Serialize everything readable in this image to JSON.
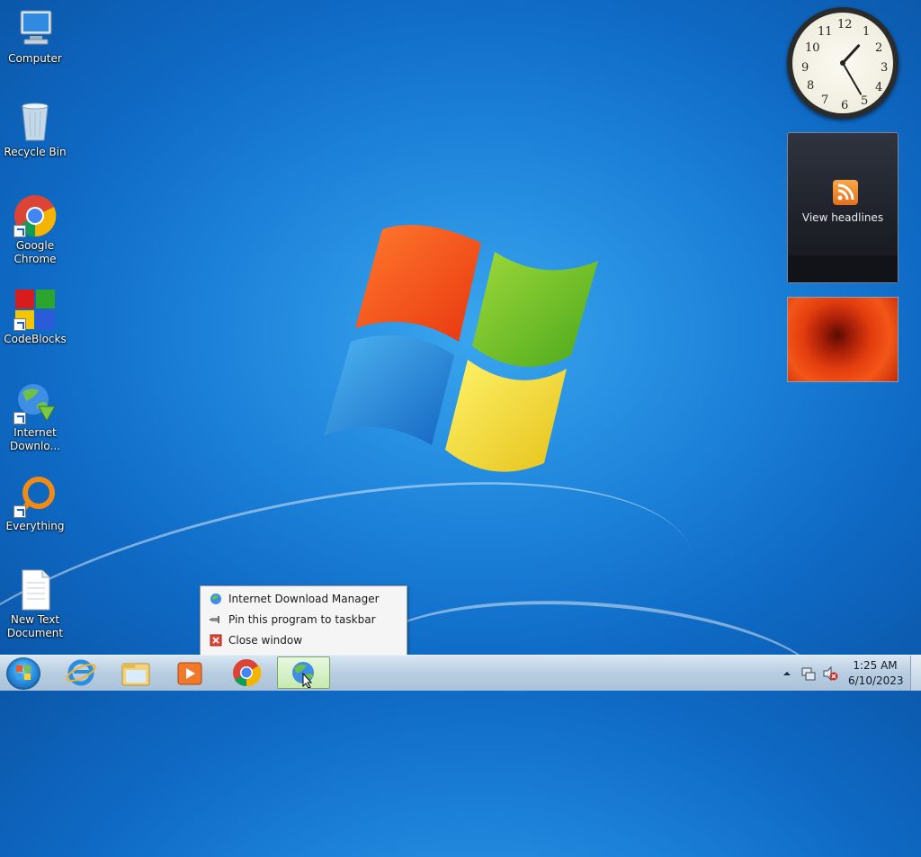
{
  "desktop": {
    "icons": [
      {
        "label": "Computer"
      },
      {
        "label": "Recycle Bin"
      },
      {
        "label": "Google Chrome"
      },
      {
        "label": "CodeBlocks"
      },
      {
        "label": "Internet Downlo..."
      },
      {
        "label": "Everything"
      },
      {
        "label": "New Text Document"
      }
    ]
  },
  "gadgets": {
    "clock": {
      "numbers": [
        "12",
        "1",
        "2",
        "3",
        "4",
        "5",
        "6",
        "7",
        "8",
        "9",
        "10",
        "11"
      ],
      "hour": 1,
      "minute": 25
    },
    "feed": {
      "label": "View headlines"
    }
  },
  "context_menu": {
    "items": [
      {
        "label": "Internet Download Manager",
        "icon": "idm-icon"
      },
      {
        "label": "Pin this program to taskbar",
        "icon": "pin-icon"
      },
      {
        "label": "Close window",
        "icon": "close-icon"
      }
    ]
  },
  "taskbar": {
    "buttons": [
      "start-icon",
      "internet-explorer-icon",
      "windows-explorer-icon",
      "media-player-icon",
      "chrome-icon",
      "internet-download-manager-icon"
    ],
    "tray": {
      "time": "1:25 AM",
      "date": "6/10/2023"
    }
  },
  "colors": {
    "accent": "#1f86dc",
    "taskbar": "#b8cde0",
    "menu_bg": "#f5f5f5"
  }
}
